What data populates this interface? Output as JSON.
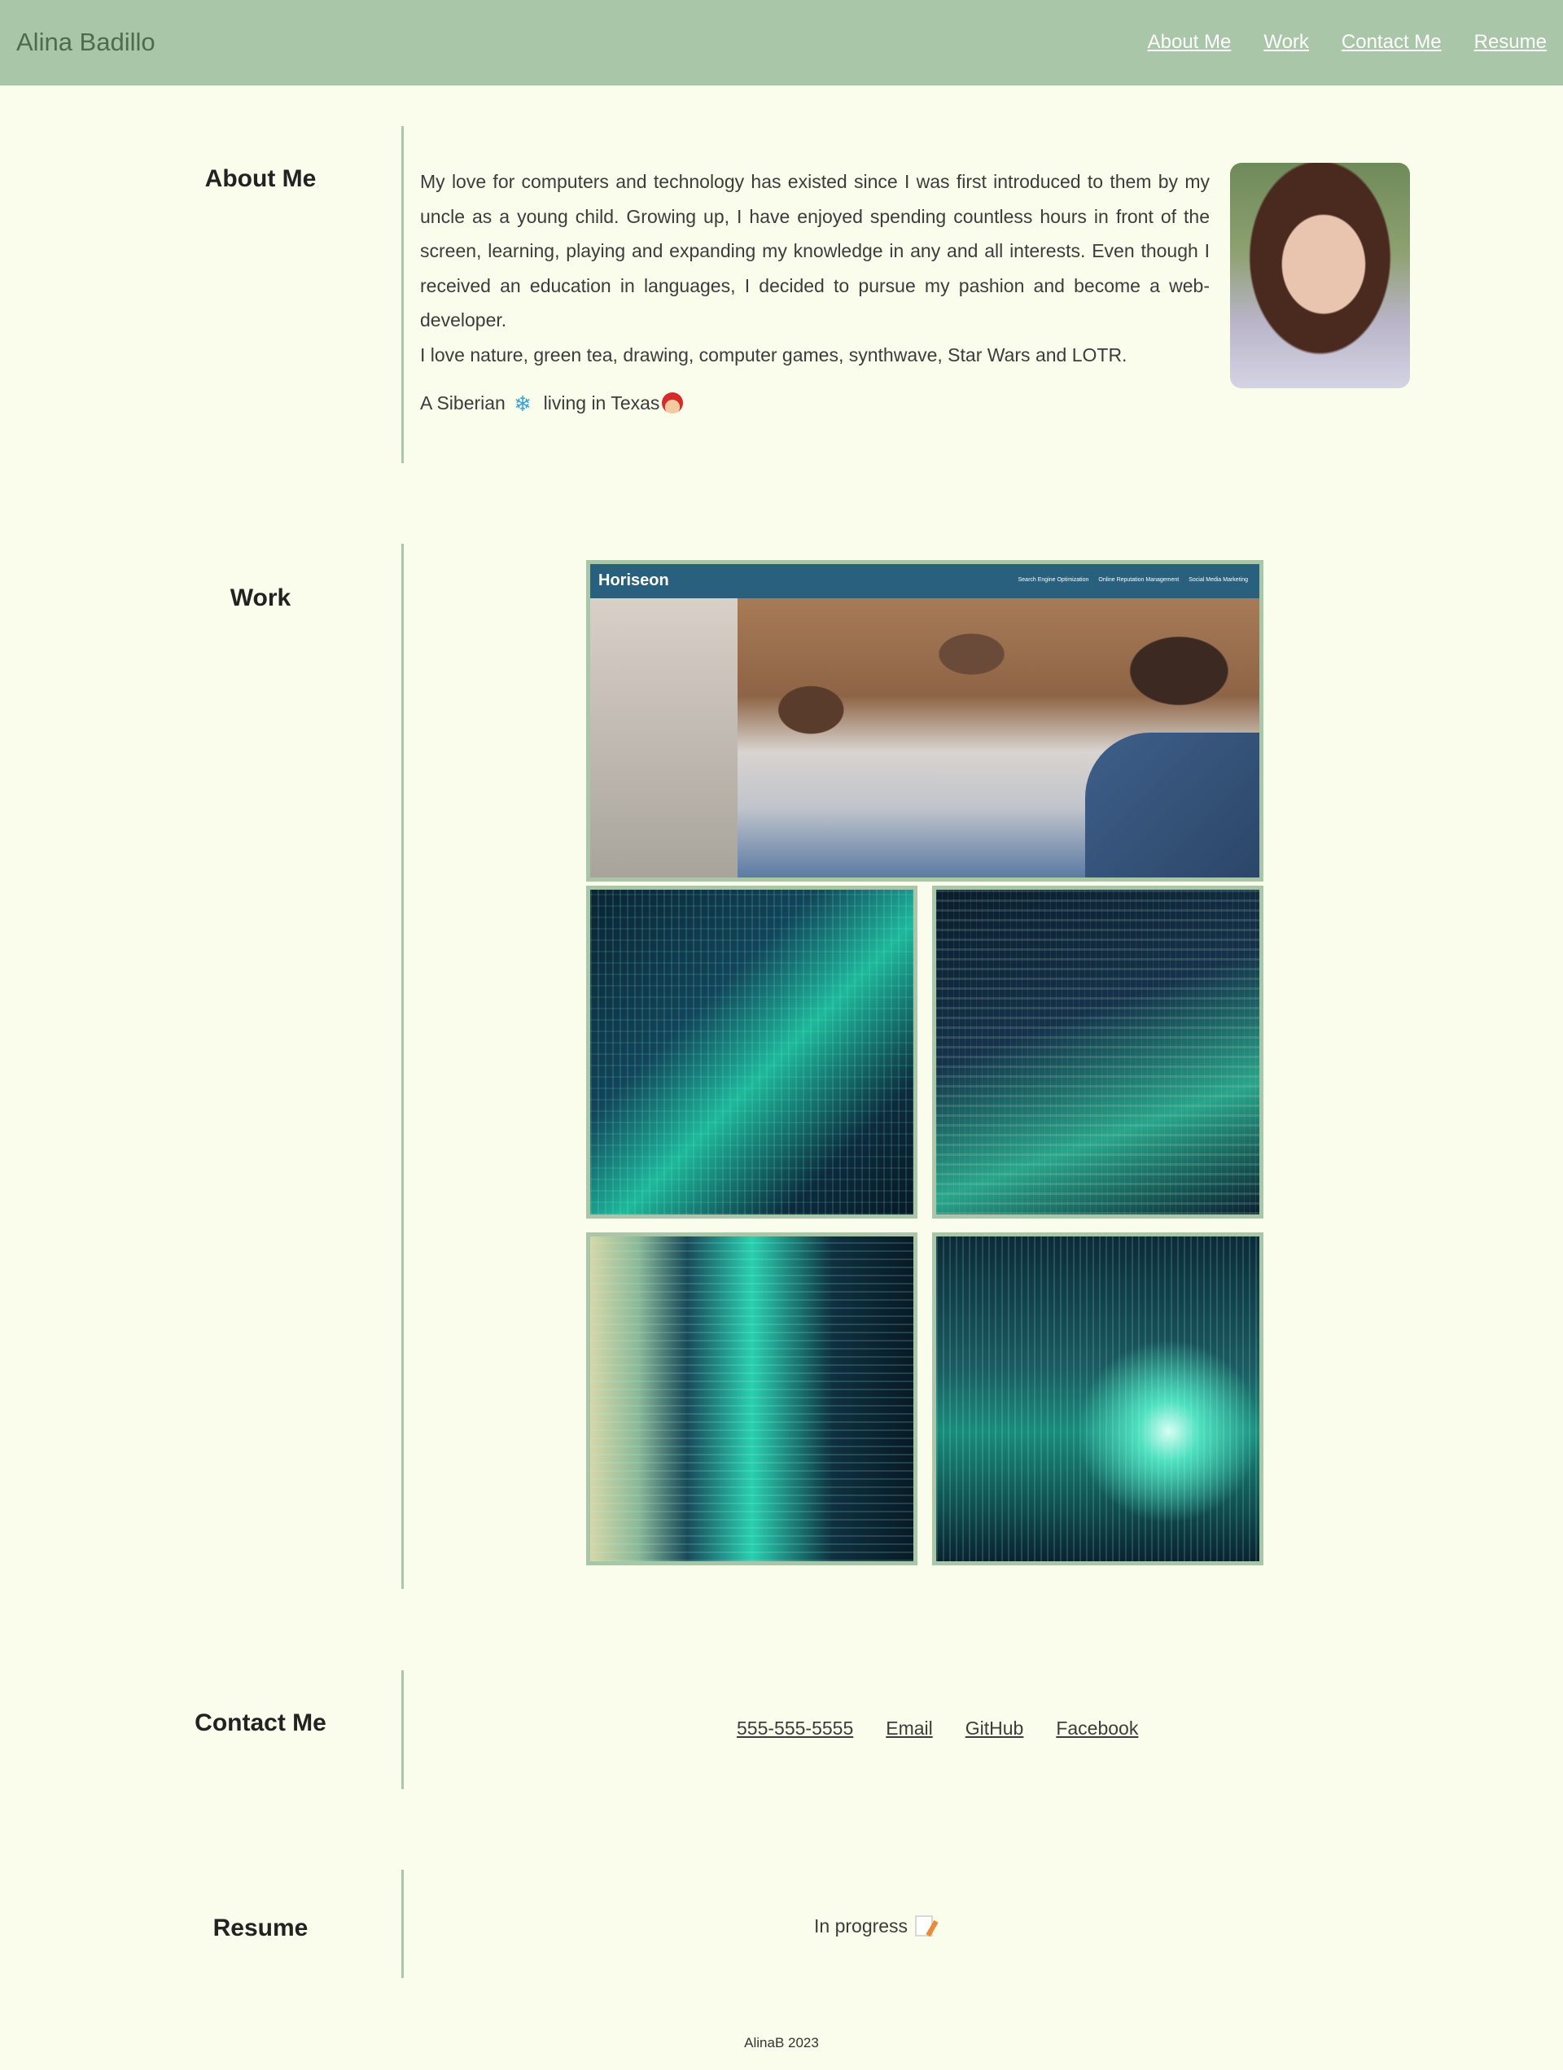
{
  "header": {
    "brand": "Alina Badillo",
    "nav": [
      "About Me",
      "Work",
      "Contact Me",
      "Resume"
    ]
  },
  "about": {
    "heading": "About Me",
    "paragraph": "My love for computers and technology has existed since I was first introduced to them by my uncle as a young child. Growing up, I have enjoyed spending countless hours in front of the screen, learning, playing and expanding my knowledge in any and all interests. Even though I received an education in languages, I decided to pursue my pashion and become a web-developer.",
    "interests": "I love nature, green tea, drawing, computer games, synthwave, Star Wars and LOTR.",
    "tagline_start": "A Siberian",
    "tagline_mid": "living in Texas",
    "snow_glyph": "❄"
  },
  "work": {
    "heading": "Work",
    "featured": {
      "site_title": "Horiseon",
      "site_nav": [
        "Search Engine Optimization",
        "Online Reputation Management",
        "Social Media Marketing"
      ]
    },
    "tiles": [
      "project-tile-1",
      "project-tile-2",
      "project-tile-3",
      "project-tile-4"
    ]
  },
  "contact": {
    "heading": "Contact Me",
    "links": [
      "555-555-5555",
      "Email",
      "GitHub",
      "Facebook"
    ]
  },
  "resume": {
    "heading": "Resume",
    "status": "In progress"
  },
  "footer": {
    "text": "AlinaB 2023"
  },
  "colors": {
    "header_bg": "#aac6a8",
    "page_bg": "#fafdeb",
    "accent_line": "#aac6a8",
    "brand_text": "#4e6b4c"
  }
}
